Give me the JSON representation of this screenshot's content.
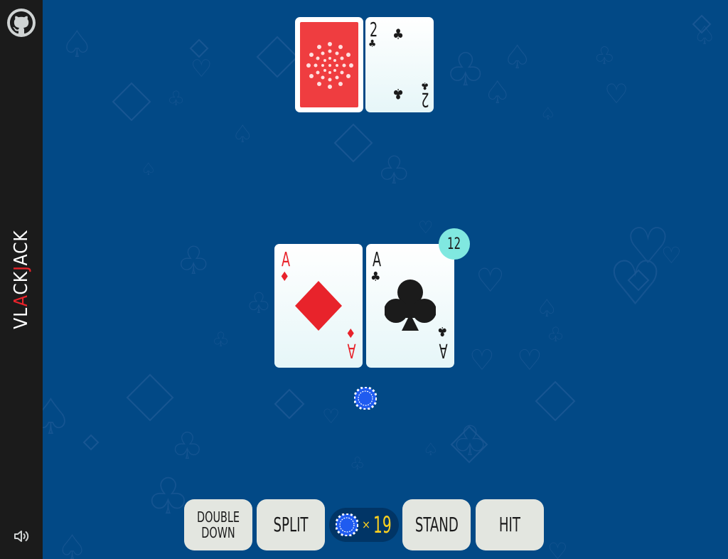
{
  "app": {
    "title_parts": [
      "VL",
      "A",
      "CK",
      "J",
      "ACK"
    ]
  },
  "icons": {
    "github": "github-icon",
    "sound": "speaker-icon",
    "chip": "poker-chip-icon"
  },
  "colors": {
    "table": "#024986",
    "sidebar": "#1b1b1b",
    "card_back": "#ef3d40",
    "badge": "#80e8e0",
    "gold": "#ffd21f",
    "chip": "#1f5bf0"
  },
  "dealer": {
    "cards": [
      {
        "face_down": true
      },
      {
        "rank": "2",
        "suit": "clubs",
        "suit_symbol": "♣"
      }
    ]
  },
  "player": {
    "score": "12",
    "cards": [
      {
        "rank": "A",
        "suit": "diamonds",
        "suit_symbol": "♦"
      },
      {
        "rank": "A",
        "suit": "clubs",
        "suit_symbol": "♣"
      }
    ],
    "bet_chips": 1
  },
  "controls": {
    "double_down": "DOUBLE DOWN",
    "split": "SPLIT",
    "stand": "STAND",
    "hit": "HIT"
  },
  "bank": {
    "multiplier": "×",
    "chips": "19"
  }
}
